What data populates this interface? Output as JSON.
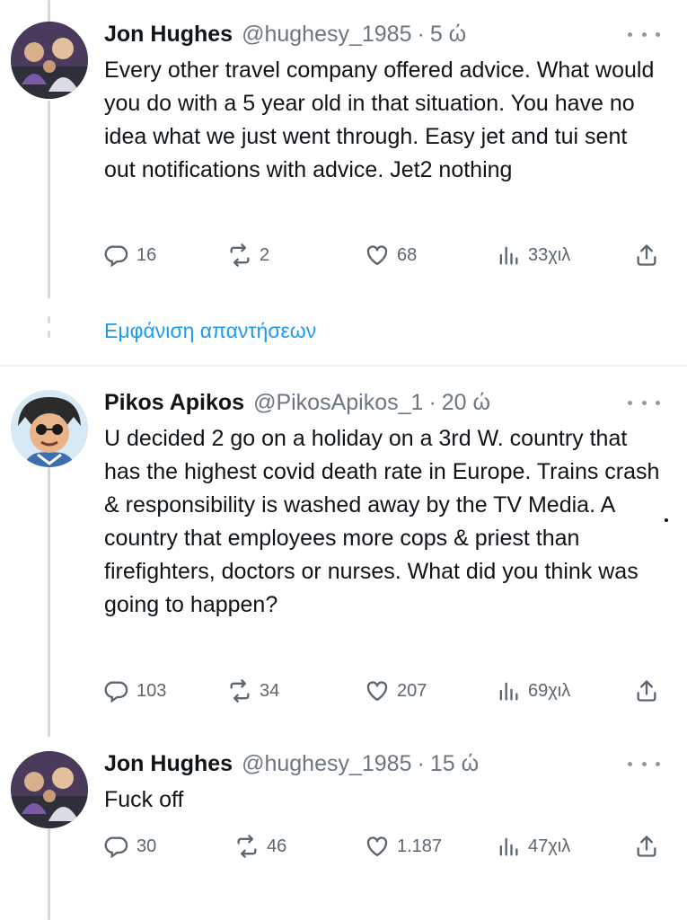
{
  "tweets": [
    {
      "display_name": "Jon Hughes",
      "handle": "@hughesy_1985",
      "separator": "·",
      "time": "5 ώ",
      "text": "Every other travel company offered advice. What would you do with a 5 year old in that situation. You have no idea what we just went through. Easy jet and tui sent out notifications with advice. Jet2 nothing",
      "stats": {
        "replies": "16",
        "reposts": "2",
        "likes": "68",
        "views": "33χιλ"
      },
      "avatar_icon": "profile-photo-group"
    },
    {
      "display_name": "Pikos Apikos",
      "handle": "@PikosApikos_1",
      "separator": "·",
      "time": "20 ώ",
      "text": "U decided 2 go on a holiday on a 3rd W. country that has the highest covid death rate in Europe. Trains crash & responsibility is washed away by the TV Media. A country that employees more cops & priest than firefighters, doctors or nurses. What did you think was going to happen?",
      "stats": {
        "replies": "103",
        "reposts": "34",
        "likes": "207",
        "views": "69χιλ"
      },
      "avatar_icon": "cartoon-avatar"
    },
    {
      "display_name": "Jon Hughes",
      "handle": "@hughesy_1985",
      "separator": "·",
      "time": "15 ώ",
      "text": "Fuck off",
      "stats": {
        "replies": "30",
        "reposts": "46",
        "likes": "1.187",
        "views": "47χιλ"
      },
      "avatar_icon": "profile-photo-group"
    }
  ],
  "show_replies_label": "Εμφάνιση απαντήσεων",
  "icons": {
    "reply": "reply-icon",
    "repost": "repost-icon",
    "like": "like-icon",
    "views": "views-icon",
    "share": "share-icon",
    "more": "more-icon"
  },
  "colors": {
    "text": "#0f1419",
    "secondary": "#6b7680",
    "link": "#1d9bf0",
    "thread_line": "#cfd9de"
  }
}
